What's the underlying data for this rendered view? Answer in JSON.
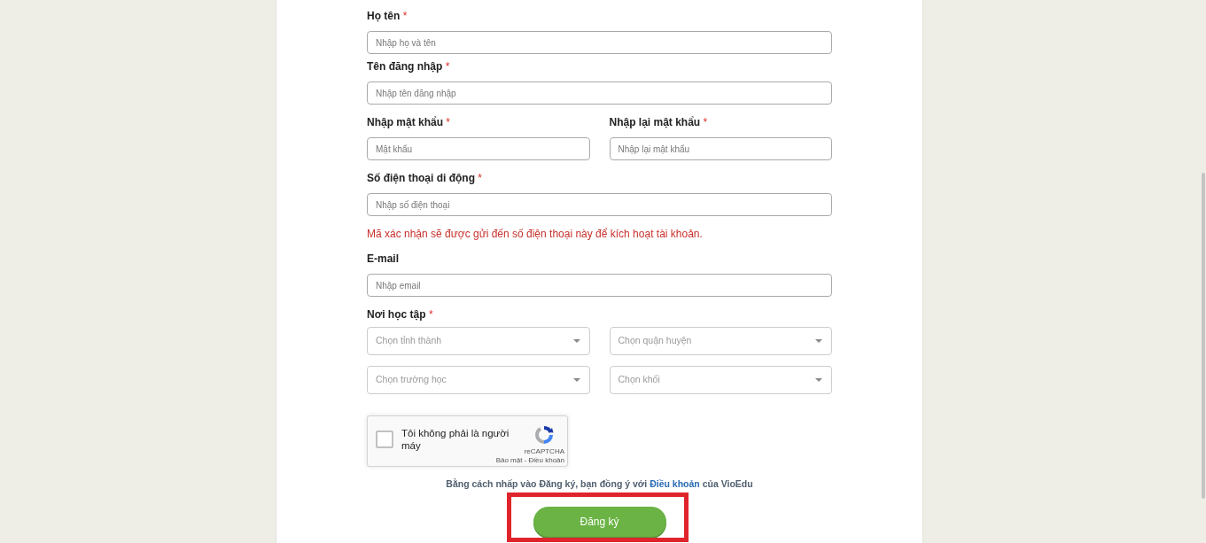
{
  "form": {
    "required_mark": "*",
    "rows": [
      {
        "fields": [
          {
            "label": "Họ tên",
            "required": true,
            "placeholder": "Nhập họ và tên"
          }
        ]
      },
      {
        "fields": [
          {
            "label": "Tên đăng nhập",
            "required": true,
            "placeholder": "Nhập tên đăng nhập"
          }
        ]
      },
      {
        "fields": [
          {
            "label": "Nhập mật khẩu",
            "required": true,
            "placeholder": "Mật khẩu"
          },
          {
            "label": "Nhập lại mật khẩu",
            "required": true,
            "placeholder": "Nhập lại mật khẩu"
          }
        ]
      },
      {
        "fields": [
          {
            "label": "Số điện thoại di động",
            "required": true,
            "placeholder": "Nhập số điện thoại"
          }
        ],
        "note": "Mã xác nhận sẽ được gửi đến số điện thoại này để kích hoạt tài khoản."
      },
      {
        "fields": [
          {
            "label": "E-mail",
            "required": false,
            "placeholder": "Nhập email"
          }
        ]
      }
    ],
    "school": {
      "label": "Nơi học tập",
      "required": true,
      "selects": [
        {
          "placeholder": "Chọn tỉnh thành"
        },
        {
          "placeholder": "Chọn quận huyện"
        },
        {
          "placeholder": "Chọn trường học"
        },
        {
          "placeholder": "Chọn khối"
        }
      ]
    }
  },
  "captcha": {
    "label": "Tôi không phải là người máy",
    "checked": false,
    "brand": "reCAPTCHA",
    "footer": "Bảo mật - Điều khoản"
  },
  "terms": {
    "before": "Bằng cách nhấp vào Đăng ký, bạn đồng ý với",
    "link": "Điều khoản",
    "after": "của VioEdu"
  },
  "submit_button": {
    "label": "Đăng ký",
    "highlighted": true
  }
}
